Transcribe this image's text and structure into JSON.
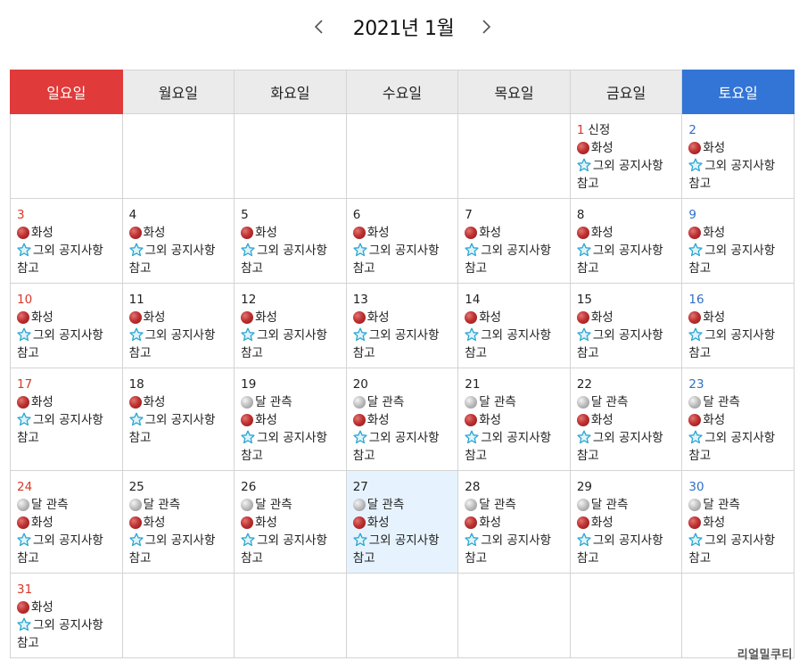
{
  "header": {
    "title": "2021년 1월",
    "prev_icon": "chevron-left",
    "next_icon": "chevron-right"
  },
  "weekdays": [
    "일요일",
    "월요일",
    "화요일",
    "수요일",
    "목요일",
    "금요일",
    "토요일"
  ],
  "colors": {
    "sunday": "#e03a3a",
    "saturday": "#3275d6",
    "today_bg": "#e6f3fe",
    "header_bg": "#ebebeb"
  },
  "event_labels": {
    "moon": "달 관측",
    "mars": "화성",
    "notice": "그외 공지사항",
    "notice_tail": "참고"
  },
  "icons": {
    "moon": "moon-icon",
    "mars": "mars-icon",
    "notice": "star-icon"
  },
  "weeks": [
    [
      null,
      null,
      null,
      null,
      null,
      {
        "day": "1",
        "holiday": "신정",
        "events": [
          "mars",
          "notice"
        ]
      },
      {
        "day": "2",
        "events": [
          "mars",
          "notice"
        ]
      }
    ],
    [
      {
        "day": "3",
        "events": [
          "mars",
          "notice"
        ]
      },
      {
        "day": "4",
        "events": [
          "mars",
          "notice"
        ]
      },
      {
        "day": "5",
        "events": [
          "mars",
          "notice"
        ]
      },
      {
        "day": "6",
        "events": [
          "mars",
          "notice"
        ]
      },
      {
        "day": "7",
        "events": [
          "mars",
          "notice"
        ]
      },
      {
        "day": "8",
        "events": [
          "mars",
          "notice"
        ]
      },
      {
        "day": "9",
        "events": [
          "mars",
          "notice"
        ]
      }
    ],
    [
      {
        "day": "10",
        "events": [
          "mars",
          "notice"
        ]
      },
      {
        "day": "11",
        "events": [
          "mars",
          "notice"
        ]
      },
      {
        "day": "12",
        "events": [
          "mars",
          "notice"
        ]
      },
      {
        "day": "13",
        "events": [
          "mars",
          "notice"
        ]
      },
      {
        "day": "14",
        "events": [
          "mars",
          "notice"
        ]
      },
      {
        "day": "15",
        "events": [
          "mars",
          "notice"
        ]
      },
      {
        "day": "16",
        "events": [
          "mars",
          "notice"
        ]
      }
    ],
    [
      {
        "day": "17",
        "events": [
          "mars",
          "notice"
        ]
      },
      {
        "day": "18",
        "events": [
          "mars",
          "notice"
        ]
      },
      {
        "day": "19",
        "events": [
          "moon",
          "mars",
          "notice"
        ]
      },
      {
        "day": "20",
        "events": [
          "moon",
          "mars",
          "notice"
        ]
      },
      {
        "day": "21",
        "events": [
          "moon",
          "mars",
          "notice"
        ]
      },
      {
        "day": "22",
        "events": [
          "moon",
          "mars",
          "notice"
        ]
      },
      {
        "day": "23",
        "events": [
          "moon",
          "mars",
          "notice"
        ]
      }
    ],
    [
      {
        "day": "24",
        "events": [
          "moon",
          "mars",
          "notice"
        ]
      },
      {
        "day": "25",
        "events": [
          "moon",
          "mars",
          "notice"
        ]
      },
      {
        "day": "26",
        "events": [
          "moon",
          "mars",
          "notice"
        ]
      },
      {
        "day": "27",
        "today": true,
        "events": [
          "moon",
          "mars",
          "notice"
        ]
      },
      {
        "day": "28",
        "events": [
          "moon",
          "mars",
          "notice"
        ]
      },
      {
        "day": "29",
        "events": [
          "moon",
          "mars",
          "notice"
        ]
      },
      {
        "day": "30",
        "events": [
          "moon",
          "mars",
          "notice"
        ]
      }
    ],
    [
      {
        "day": "31",
        "events": [
          "mars",
          "notice"
        ]
      },
      null,
      null,
      null,
      null,
      null,
      null
    ]
  ],
  "watermark": "리얼밀쿠티"
}
